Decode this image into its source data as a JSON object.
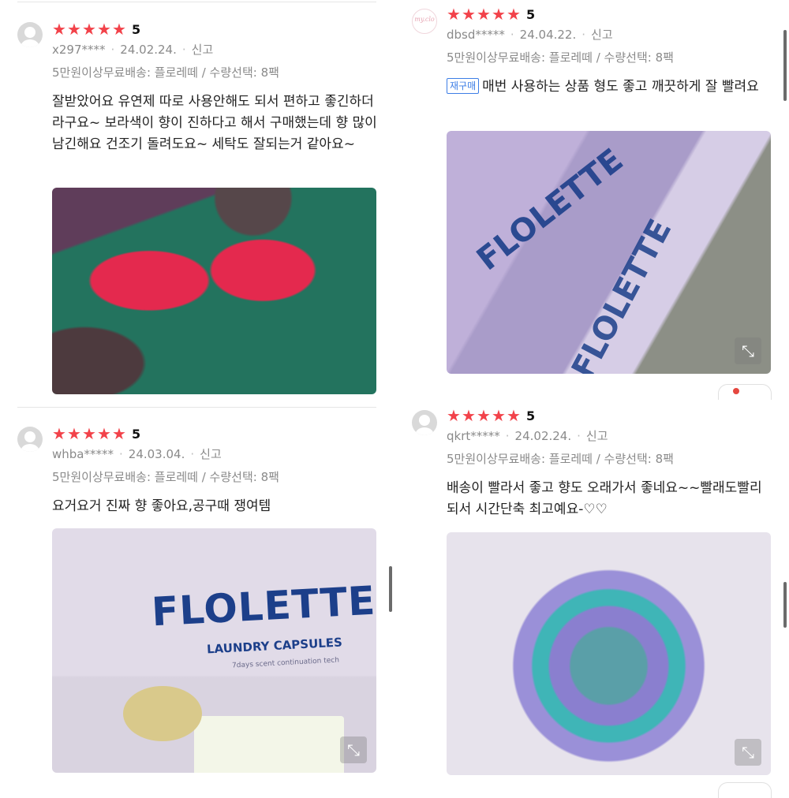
{
  "reviews": [
    {
      "user": "x297****",
      "date": "24.02.24.",
      "report": "신고",
      "score": "5",
      "option": "5만원이상무료배송: 플로레떼 / 수량선택: 8팩",
      "badge": "",
      "text": "잘받았어요 유연제 따로 사용안해도 되서 편하고 좋긴하더라구요~ 보라색이 향이 진하다고 해서 구매했는데 향 많이 남긴해요 건조기 돌려도요~ 세탁도 잘되는거 같아요~",
      "brand": ""
    },
    {
      "user": "dbsd*****",
      "date": "24.04.22.",
      "report": "신고",
      "score": "5",
      "option": "5만원이상무료배송: 플로레떼 / 수량선택: 8팩",
      "badge": "재구매",
      "text": "매번 사용하는 상품 형도 좋고 깨끗하게 잘 빨려요",
      "brand": "FLOLETTE",
      "avatar_text": "my.clo"
    },
    {
      "user": "whba*****",
      "date": "24.03.04.",
      "report": "신고",
      "score": "5",
      "option": "5만원이상무료배송: 플로레떼 / 수량선택: 8팩",
      "badge": "",
      "text": "요거요거 진짜 향 좋아요,공구때 쟁여템",
      "brand": "FLOLETTE",
      "brand_sub": "LAUNDRY CAPSULES",
      "brand_tag": "7days scent continuation tech"
    },
    {
      "user": "qkrt*****",
      "date": "24.02.24.",
      "report": "신고",
      "score": "5",
      "option": "5만원이상무료배송: 플로레떼 / 수량선택: 8팩",
      "badge": "",
      "text": "배송이 빨라서 좋고 향도 오래가서 좋네요~~빨래도빨리되서 시간단축 최고예요-♡♡",
      "brand": ""
    }
  ],
  "icons": {
    "star": "★",
    "expand": "⤡"
  }
}
